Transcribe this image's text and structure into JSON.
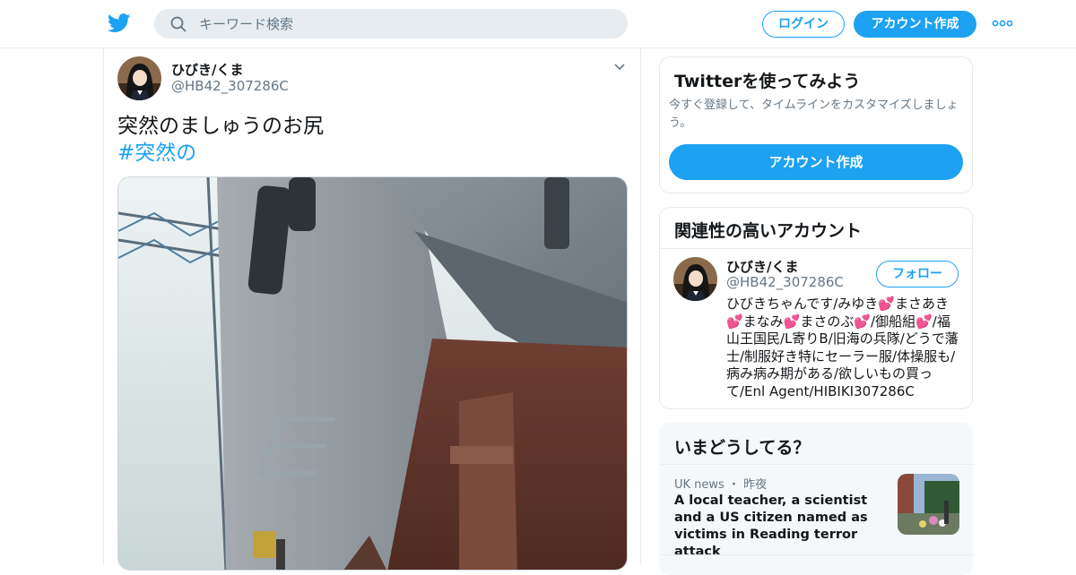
{
  "header": {
    "search_placeholder": "キーワード検索",
    "login_label": "ログイン",
    "signup_label": "アカウント作成"
  },
  "tweet": {
    "display_name": "ひびき/くま",
    "handle": "@HB42_307286C",
    "text": "突然のましゅうのお尻",
    "hashtag": "#突然の"
  },
  "signup_card": {
    "title": "Twitterを使ってみよう",
    "subtitle": "今すぐ登録して、タイムラインをカスタマイズしましょう。",
    "button_label": "アカウント作成"
  },
  "related_card": {
    "title": "関連性の高いアカウント",
    "account": {
      "display_name": "ひびき/くま",
      "handle": "@HB42_307286C",
      "follow_label": "フォロー",
      "bio": "ひびきちゃんです/みゆき💕まさあき💕まなみ💕まさのぶ💕/御船組💕/福山王国民/L寄りB/旧海の兵隊/どうで藩士/制服好き特にセーラー服/体操服も/病み病み期がある/欲しいもの買って/Enl Agent/HIBIKI307286C"
    }
  },
  "trends_card": {
    "title": "いまどうしてる？",
    "item": {
      "category": "UK news",
      "time": "昨夜",
      "headline": "A local teacher, a scientist and a US citizen named as victims in Reading terror attack"
    }
  },
  "colors": {
    "accent": "#1da1f2",
    "text": "#14171a",
    "muted": "#657786",
    "border": "#e6ecf0"
  },
  "icons": [
    "twitter-bird-logo-icon",
    "search-icon",
    "more-dots-icon",
    "chevron-down-icon"
  ]
}
